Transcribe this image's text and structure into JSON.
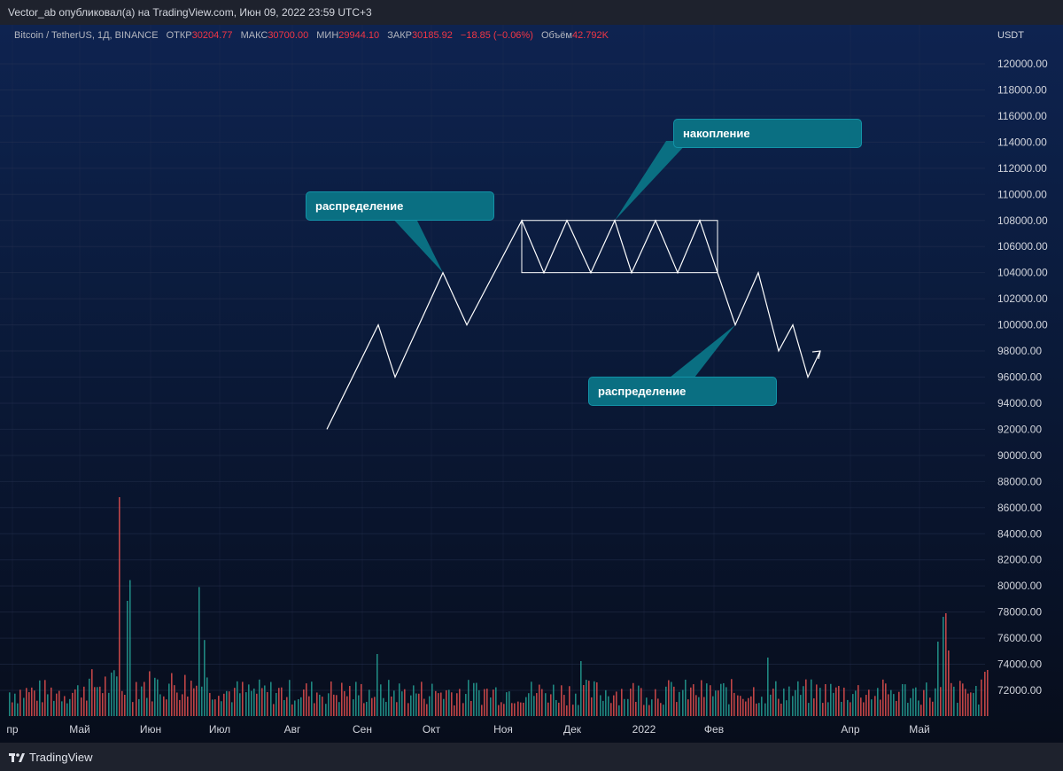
{
  "header": {
    "published_by": "Vector_ab опубликовал(а) на TradingView.com, Июн 09, 2022 23:59 UTC+3"
  },
  "legend": {
    "symbol": "Bitcoin / TetherUS, 1Д, BINANCE",
    "open_label": "ОТКР",
    "open": "30204.77",
    "high_label": "МАКС",
    "high": "30700.00",
    "low_label": "МИН",
    "low": "29944.10",
    "close_label": "ЗАКР",
    "close": "30185.92",
    "change": "−18.85 (−0.06%)",
    "volume_label": "Объём",
    "volume": "42.792K"
  },
  "currency": "USDT",
  "footer": {
    "brand": "TradingView"
  },
  "annotations": {
    "left": "распределение",
    "top": "накопление",
    "bottom": "распределение"
  },
  "colors": {
    "volume_up": "#26a69a",
    "volume_down": "#ef5350",
    "callout": "#0a6f82",
    "price_line": "#ffffff",
    "change": "#f23645"
  },
  "chart_data": {
    "type": "line",
    "y_axis": {
      "ticks": [
        120000,
        118000,
        116000,
        114000,
        112000,
        110000,
        108000,
        106000,
        104000,
        102000,
        100000,
        98000,
        96000,
        94000,
        92000,
        90000,
        88000,
        86000,
        84000,
        82000,
        80000,
        78000,
        76000,
        74000,
        72000
      ],
      "tick_labels": [
        "120000.00",
        "118000.00",
        "116000.00",
        "114000.00",
        "112000.00",
        "110000.00",
        "108000.00",
        "106000.00",
        "104000.00",
        "102000.00",
        "100000.00",
        "98000.00",
        "96000.00",
        "94000.00",
        "92000.00",
        "90000.00",
        "88000.00",
        "86000.00",
        "84000.00",
        "82000.00",
        "80000.00",
        "78000.00",
        "76000.00",
        "74000.00",
        "72000.00"
      ],
      "ylim": [
        70500,
        121500
      ]
    },
    "x_axis": {
      "labels": [
        "пр",
        "Май",
        "Июн",
        "Июл",
        "Авг",
        "Сен",
        "Окт",
        "Ноя",
        "Дек",
        "2022",
        "Фев",
        "Апр",
        "Май"
      ]
    },
    "projection": {
      "points": [
        [
          "Авг",
          92000
        ],
        [
          "Сен",
          100000
        ],
        [
          "Сен",
          96000
        ],
        [
          "Окт",
          104000
        ],
        [
          "Окт",
          100000
        ],
        [
          "Ноя",
          108000
        ],
        [
          "Ноя",
          104000
        ],
        [
          "Ноя",
          108000
        ],
        [
          "Дек",
          104000
        ],
        [
          "Дек",
          108000
        ],
        [
          "Дек",
          104000
        ],
        [
          "Дек",
          108000
        ],
        [
          "2022",
          104000
        ],
        [
          "2022",
          108000
        ],
        [
          "Фев",
          104000
        ],
        [
          "Фев",
          100000
        ],
        [
          "Фев",
          104000
        ],
        [
          "Фев",
          98000
        ],
        [
          "Фев",
          100000
        ],
        [
          "Апр",
          96000
        ],
        [
          "Апр",
          98000
        ]
      ]
    },
    "accumulation_range": {
      "from": "Ноя",
      "to": "Фев",
      "low": 104000,
      "high": 108000
    },
    "volume": {
      "series": "Объём",
      "peak_bars": [
        "Июн",
        "Май"
      ]
    }
  }
}
